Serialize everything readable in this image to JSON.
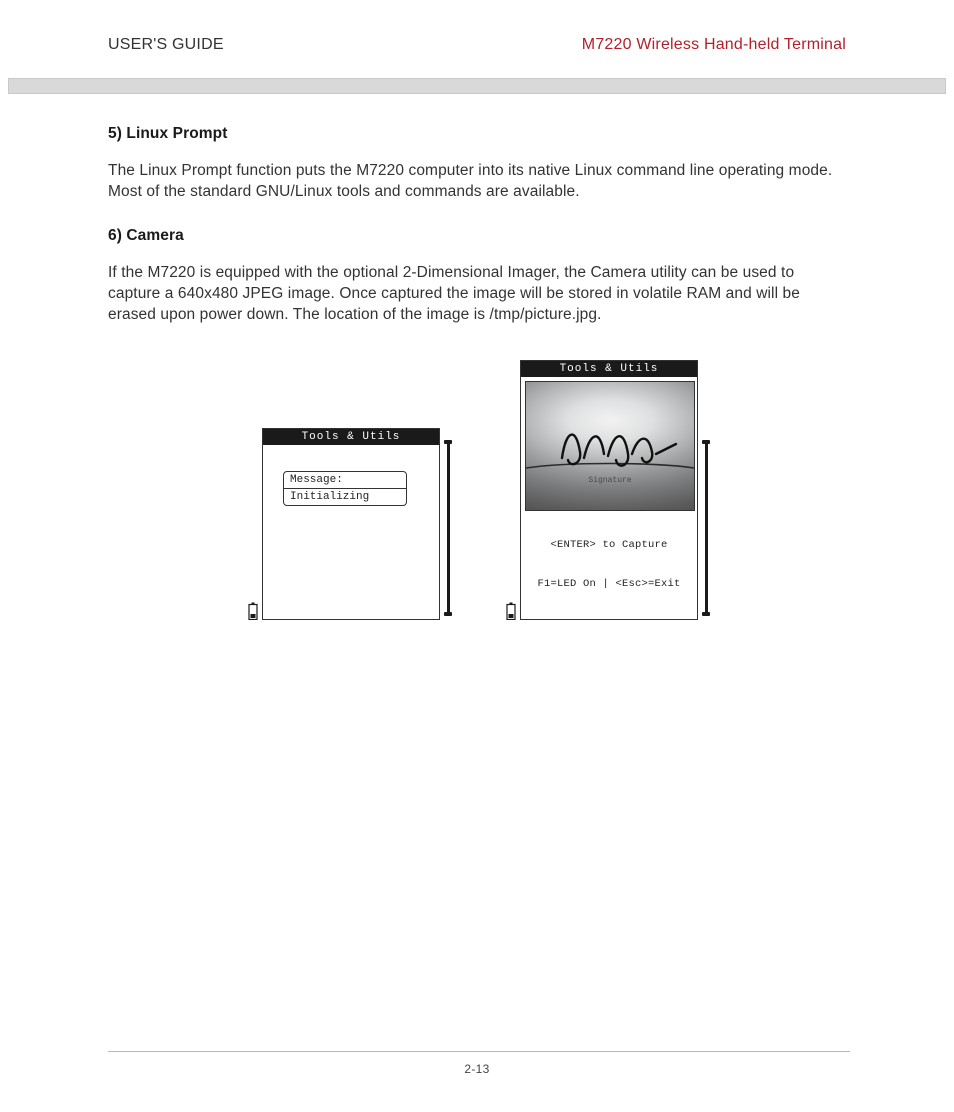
{
  "header": {
    "left": "USER'S GUIDE",
    "right": "M7220 Wireless Hand-held Terminal"
  },
  "sections": {
    "linux": {
      "title": "5) Linux Prompt",
      "body": "The Linux Prompt function puts the M7220 computer into its native Linux command line operating mode.  Most of the standard GNU/Linux tools and commands are available."
    },
    "camera": {
      "title": "6) Camera",
      "body": "If the M7220 is equipped with the optional 2-Dimensional Imager, the Camera utility can be used to capture a 640x480 JPEG image.  Once captured the image will be stored in volatile RAM and will be erased upon power down.  The location of the image is /tmp/picture.jpg."
    }
  },
  "device_screens": {
    "titlebar": "Tools & Utils",
    "message_box": {
      "line1": "Message:",
      "line2": "Initializing"
    },
    "camera_preview": {
      "caption_label": "Signature"
    },
    "camera_footer": {
      "line1": "<ENTER> to Capture",
      "line2": "F1=LED On | <Esc>=Exit"
    }
  },
  "footer": {
    "page": "2-13"
  }
}
